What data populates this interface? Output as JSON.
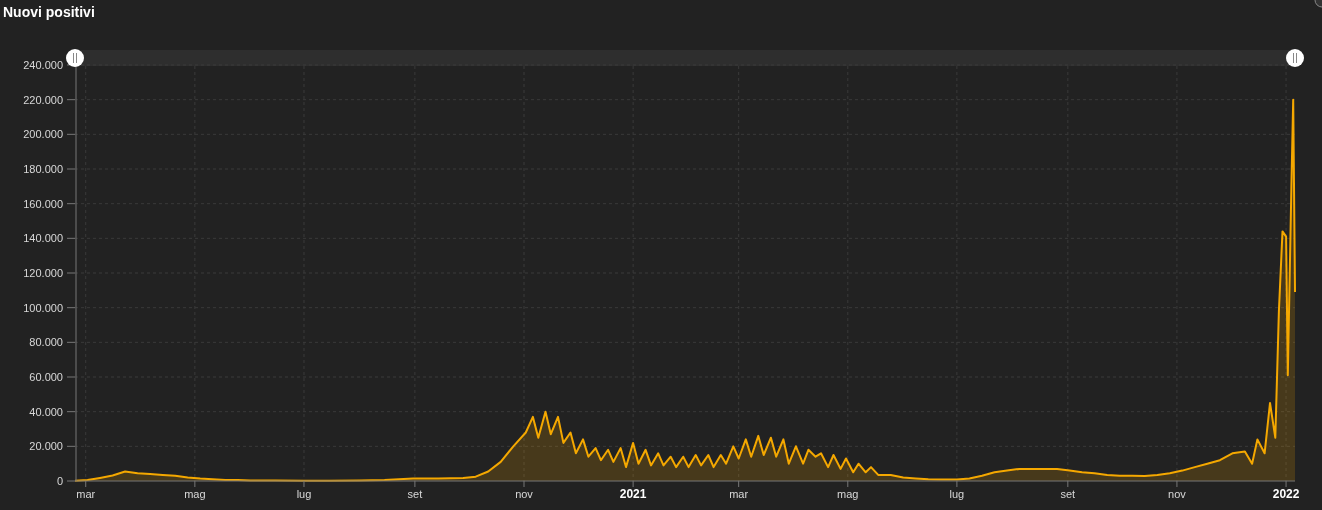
{
  "title": "Nuovi positivi",
  "chart": {
    "chart_data": {
      "type": "area",
      "x": [
        "2020-02-24",
        "2020-03-02",
        "2020-03-09",
        "2020-03-16",
        "2020-03-23",
        "2020-03-30",
        "2020-04-06",
        "2020-04-13",
        "2020-04-20",
        "2020-04-27",
        "2020-05-04",
        "2020-05-11",
        "2020-05-18",
        "2020-05-25",
        "2020-06-01",
        "2020-06-15",
        "2020-07-01",
        "2020-07-15",
        "2020-08-01",
        "2020-08-15",
        "2020-08-31",
        "2020-09-14",
        "2020-09-28",
        "2020-10-05",
        "2020-10-12",
        "2020-10-19",
        "2020-10-26",
        "2020-11-02",
        "2020-11-06",
        "2020-11-09",
        "2020-11-13",
        "2020-11-16",
        "2020-11-20",
        "2020-11-23",
        "2020-11-27",
        "2020-11-30",
        "2020-12-04",
        "2020-12-07",
        "2020-12-11",
        "2020-12-14",
        "2020-12-18",
        "2020-12-21",
        "2020-12-25",
        "2020-12-28",
        "2021-01-01",
        "2021-01-04",
        "2021-01-08",
        "2021-01-11",
        "2021-01-15",
        "2021-01-18",
        "2021-01-22",
        "2021-01-25",
        "2021-01-29",
        "2021-02-01",
        "2021-02-05",
        "2021-02-08",
        "2021-02-12",
        "2021-02-15",
        "2021-02-19",
        "2021-02-22",
        "2021-02-26",
        "2021-03-01",
        "2021-03-05",
        "2021-03-08",
        "2021-03-12",
        "2021-03-15",
        "2021-03-19",
        "2021-03-22",
        "2021-03-26",
        "2021-03-29",
        "2021-04-02",
        "2021-04-06",
        "2021-04-09",
        "2021-04-13",
        "2021-04-16",
        "2021-04-20",
        "2021-04-23",
        "2021-04-27",
        "2021-04-30",
        "2021-05-04",
        "2021-05-07",
        "2021-05-11",
        "2021-05-14",
        "2021-05-18",
        "2021-05-25",
        "2021-06-01",
        "2021-06-08",
        "2021-06-15",
        "2021-06-22",
        "2021-07-01",
        "2021-07-08",
        "2021-07-15",
        "2021-07-22",
        "2021-07-29",
        "2021-08-05",
        "2021-08-12",
        "2021-08-19",
        "2021-08-26",
        "2021-09-02",
        "2021-09-09",
        "2021-09-16",
        "2021-09-23",
        "2021-09-30",
        "2021-10-07",
        "2021-10-14",
        "2021-10-21",
        "2021-10-28",
        "2021-11-04",
        "2021-11-11",
        "2021-11-18",
        "2021-11-25",
        "2021-12-02",
        "2021-12-09",
        "2021-12-13",
        "2021-12-16",
        "2021-12-20",
        "2021-12-23",
        "2021-12-26",
        "2021-12-28",
        "2021-12-30",
        "2022-01-01",
        "2022-01-02",
        "2022-01-04",
        "2022-01-05",
        "2022-01-06"
      ],
      "series": [
        {
          "color": "#f5a800",
          "values": [
            200,
            500,
            1800,
            3200,
            5500,
            4500,
            4000,
            3500,
            3000,
            2000,
            1400,
            1000,
            600,
            500,
            300,
            300,
            200,
            200,
            300,
            600,
            1400,
            1500,
            1800,
            2500,
            5500,
            11000,
            20000,
            28000,
            37000,
            25000,
            40000,
            27000,
            37000,
            22000,
            28000,
            16000,
            24000,
            14000,
            19000,
            12000,
            18000,
            11000,
            19000,
            8000,
            22000,
            10000,
            18000,
            9000,
            16000,
            9000,
            14000,
            8000,
            14000,
            8000,
            15000,
            9000,
            15000,
            8000,
            15000,
            10000,
            20000,
            13000,
            24000,
            14000,
            26000,
            15000,
            25000,
            14000,
            24000,
            10000,
            20000,
            10000,
            18000,
            14000,
            16000,
            8000,
            15000,
            7000,
            13000,
            5000,
            10000,
            5000,
            8000,
            3500,
            3500,
            2000,
            1500,
            1000,
            800,
            800,
            1500,
            3000,
            5000,
            6000,
            7000,
            7000,
            7000,
            7000,
            6000,
            5000,
            4500,
            3500,
            3000,
            3000,
            2800,
            3500,
            4500,
            6000,
            8000,
            10000,
            12000,
            16000,
            17000,
            10000,
            24000,
            16000,
            45000,
            25000,
            98000,
            144000,
            141000,
            61000,
            170000,
            220000,
            109000
          ]
        }
      ],
      "xlim": [
        "2020-02-24",
        "2022-01-06"
      ],
      "ylim": [
        0,
        240000
      ],
      "grid": true,
      "xticks": [
        {
          "value": "2020-03-01",
          "label": "mar"
        },
        {
          "value": "2020-05-01",
          "label": "mag"
        },
        {
          "value": "2020-07-01",
          "label": "lug"
        },
        {
          "value": "2020-09-01",
          "label": "set"
        },
        {
          "value": "2020-11-01",
          "label": "nov"
        },
        {
          "value": "2021-01-01",
          "label": "2021"
        },
        {
          "value": "2021-03-01",
          "label": "mar"
        },
        {
          "value": "2021-05-01",
          "label": "mag"
        },
        {
          "value": "2021-07-01",
          "label": "lug"
        },
        {
          "value": "2021-09-01",
          "label": "set"
        },
        {
          "value": "2021-11-01",
          "label": "nov"
        },
        {
          "value": "2022-01-01",
          "label": "2022"
        }
      ],
      "yticks": [
        {
          "value": 0,
          "label": "0"
        },
        {
          "value": 20000,
          "label": "20.000"
        },
        {
          "value": 40000,
          "label": "40.000"
        },
        {
          "value": 60000,
          "label": "60.000"
        },
        {
          "value": 80000,
          "label": "80.000"
        },
        {
          "value": 100000,
          "label": "100.000"
        },
        {
          "value": 120000,
          "label": "120.000"
        },
        {
          "value": 140000,
          "label": "140.000"
        },
        {
          "value": 160000,
          "label": "160.000"
        },
        {
          "value": 180000,
          "label": "180.000"
        },
        {
          "value": 200000,
          "label": "200.000"
        },
        {
          "value": 220000,
          "label": "220.000"
        },
        {
          "value": 240000,
          "label": "240.000"
        }
      ]
    }
  }
}
